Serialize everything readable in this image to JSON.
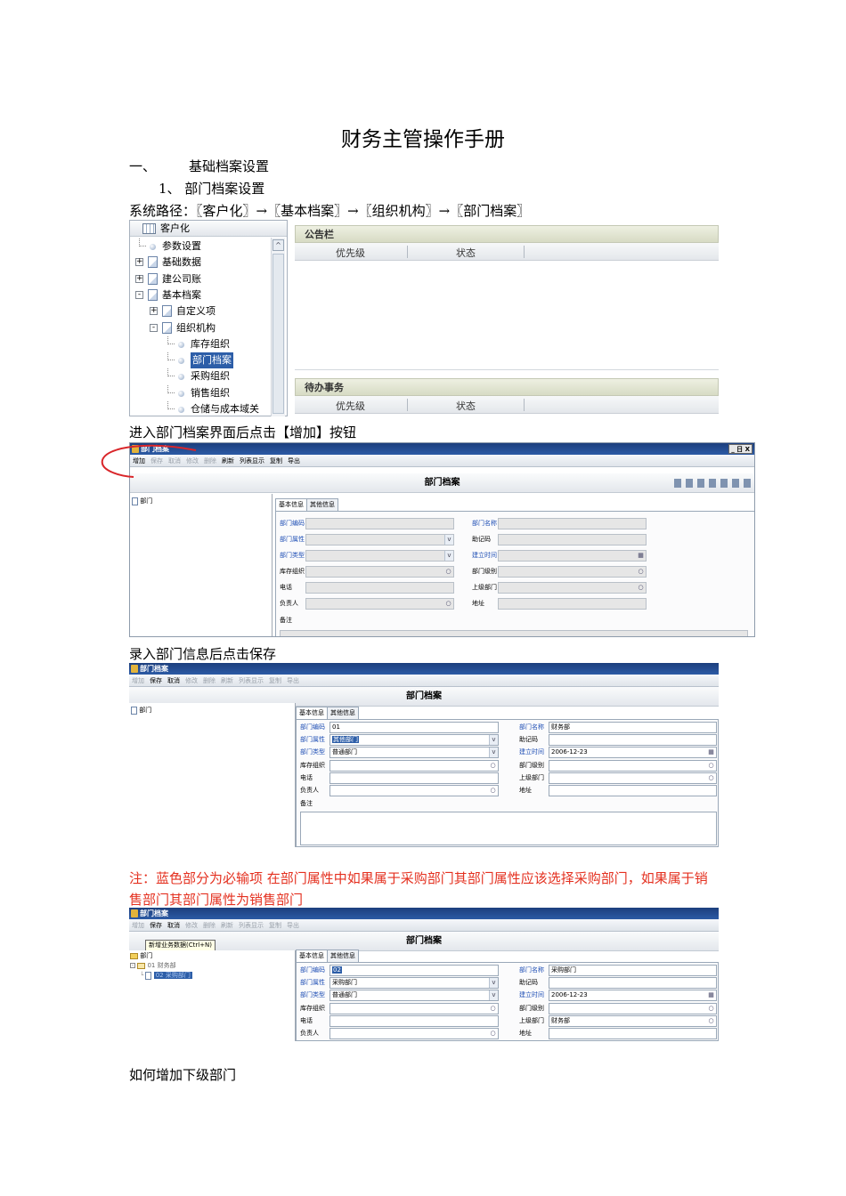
{
  "title": "财务主管操作手册",
  "section1": {
    "num": "一、",
    "label": "基础档案设置"
  },
  "sub1": "1、 部门档案设置",
  "path": "系统路径：〖客户化〗→〖基本档案〗→〖组织机构〗→〖部门档案〗",
  "caption_add": "进入部门档案界面后点击【增加】按钮",
  "caption_save": "录入部门信息后点击保存",
  "note": "注：蓝色部分为必输项 在部门属性中如果属于采购部门其部门属性应该选择采购部门，如果属于销售部门其部门属性为销售部门",
  "caption_sub": "如何增加下级部门",
  "shot1": {
    "header": "客户化",
    "tree": [
      {
        "label": "参数设置",
        "indent": 0,
        "expander": "",
        "icon": "bullet"
      },
      {
        "label": "基础数据",
        "indent": 0,
        "expander": "+",
        "icon": "doc"
      },
      {
        "label": "建公司账",
        "indent": 0,
        "expander": "+",
        "icon": "doc"
      },
      {
        "label": "基本档案",
        "indent": 0,
        "expander": "-",
        "icon": "doc"
      },
      {
        "label": "自定义项",
        "indent": 1,
        "expander": "+",
        "icon": "doc"
      },
      {
        "label": "组织机构",
        "indent": 1,
        "expander": "-",
        "icon": "doc"
      },
      {
        "label": "库存组织",
        "indent": 2,
        "expander": "",
        "icon": "bullet"
      },
      {
        "label": "部门档案",
        "indent": 2,
        "expander": "",
        "icon": "bullet",
        "selected": true
      },
      {
        "label": "采购组织",
        "indent": 2,
        "expander": "",
        "icon": "bullet"
      },
      {
        "label": "销售组织",
        "indent": 2,
        "expander": "",
        "icon": "bullet"
      },
      {
        "label": "仓储与成本域关",
        "indent": 2,
        "expander": "",
        "icon": "bullet"
      }
    ],
    "notice_title": "公告栏",
    "todo_title": "待办事务",
    "col_priority": "优先级",
    "col_status": "状态"
  },
  "win": {
    "title": "部门档案",
    "header": "部门档案",
    "tree_root": "部门",
    "tab_basic": "基本信息",
    "tab_other": "其他信息",
    "win_buttons": "_ 日 X",
    "tooltip": "新增业务数据(Ctrl+N)",
    "toolbar": [
      {
        "label": "增加",
        "state": "on"
      },
      {
        "label": "保存",
        "state": "off"
      },
      {
        "label": "取消",
        "state": "off"
      },
      {
        "label": "修改",
        "state": "off"
      },
      {
        "label": "删除",
        "state": "off"
      },
      {
        "label": "刷新",
        "state": "on"
      },
      {
        "label": "列表显示",
        "state": "on"
      },
      {
        "label": "复制",
        "state": "on"
      },
      {
        "label": "导出",
        "state": "on"
      }
    ],
    "toolbar_edit": [
      {
        "label": "增加",
        "state": "off"
      },
      {
        "label": "保存",
        "state": "on"
      },
      {
        "label": "取消",
        "state": "on"
      },
      {
        "label": "修改",
        "state": "off"
      },
      {
        "label": "删除",
        "state": "off"
      },
      {
        "label": "刷新",
        "state": "off"
      },
      {
        "label": "列表显示",
        "state": "off"
      },
      {
        "label": "复制",
        "state": "off"
      },
      {
        "label": "导出",
        "state": "off"
      }
    ],
    "labels": {
      "code": "部门编码",
      "name": "部门名称",
      "attr": "部门属性",
      "mnemonic": "助记码",
      "type": "部门类型",
      "created": "建立时间",
      "inv_org": "库存组织",
      "level": "部门级别",
      "phone": "电话",
      "parent": "上级部门",
      "manager": "负责人",
      "address": "地址",
      "remark": "备注"
    }
  },
  "shot3": {
    "code": "01",
    "name": "财务部",
    "attr": "其他部门",
    "type": "普通部门",
    "created": "2006-12-23"
  },
  "shot4": {
    "tree_child": "01 财务部",
    "tree_grandchild": "02 采购部门",
    "code": "02",
    "name": "采购部门",
    "attr": "采购部门",
    "type": "普通部门",
    "created": "2006-12-23",
    "parent": "财务部"
  },
  "colors": {
    "required_label": "#1f4fb5",
    "note_text": "#e4301f",
    "highlight_circle": "#d9262a"
  }
}
